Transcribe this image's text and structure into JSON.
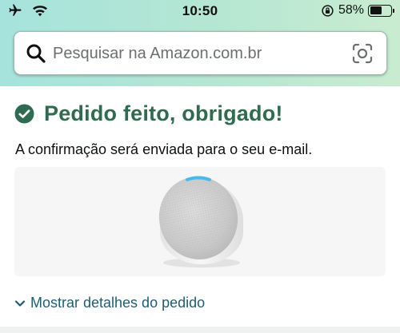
{
  "status_bar": {
    "time": "10:50",
    "battery_percent": "58%",
    "battery_level": 0.58
  },
  "search": {
    "placeholder": "Pesquisar na Amazon.com.br"
  },
  "confirmation": {
    "title": "Pedido feito, obrigado!",
    "subtitle": "A confirmação será enviada para o seu e-mail."
  },
  "order": {
    "details_link": "Mostrar detalhes do pedido"
  },
  "colors": {
    "success_green": "#2f6b50",
    "link_teal": "#1e5d72",
    "header_gradient_start": "#a6e3dd",
    "header_gradient_end": "#c9ecd0"
  },
  "icons": [
    "airplane-icon",
    "wifi-icon",
    "orientation-lock-icon",
    "battery-icon",
    "search-icon",
    "camera-scan-icon",
    "check-circle-icon",
    "chevron-down-icon"
  ]
}
